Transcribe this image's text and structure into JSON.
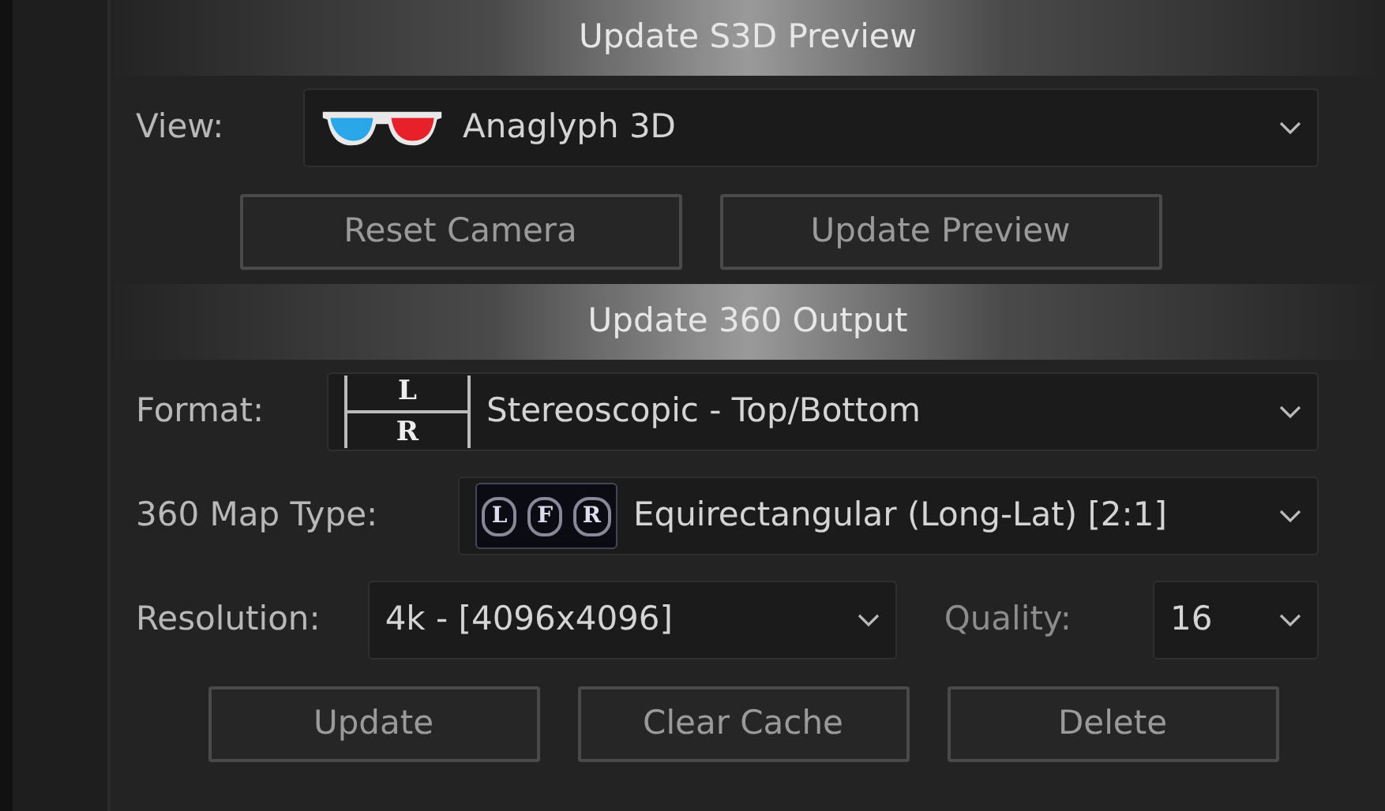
{
  "sections": [
    {
      "title": "Update S3D Preview",
      "rows": [
        {
          "kind": "view",
          "label": "View:",
          "value": "Anaglyph 3D"
        },
        {
          "kind": "buttons",
          "buttons": [
            "Reset Camera",
            "Update Preview"
          ]
        }
      ]
    },
    {
      "title": "Update 360 Output",
      "rows": [
        {
          "kind": "format",
          "label": "Format:",
          "icon_text": [
            "L",
            "R"
          ],
          "value": "Stereoscopic - Top/Bottom"
        },
        {
          "kind": "maptype",
          "label": "360 Map Type:",
          "icon_text": [
            "L",
            "F",
            "R"
          ],
          "value": "Equirectangular (Long-Lat) [2:1]"
        },
        {
          "kind": "pair",
          "label": "Resolution:",
          "value": "4k - [4096x4096]",
          "label_2": "Quality:",
          "value_2": "16"
        },
        {
          "kind": "buttons",
          "buttons": [
            "Update",
            "Clear Cache",
            "Delete"
          ]
        }
      ]
    }
  ]
}
